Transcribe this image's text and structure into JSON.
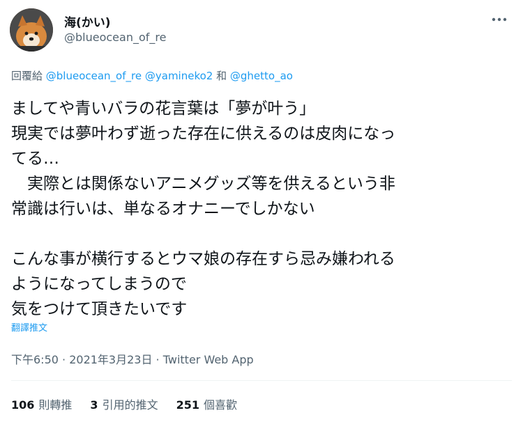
{
  "author": {
    "display_name": "海(かい)",
    "handle": "@blueocean_of_re",
    "avatar_icon": "shiba-dog-avatar"
  },
  "more_icon": "more-horizontal-icon",
  "reply": {
    "prefix": "回覆給 ",
    "mentions": [
      "@blueocean_of_re",
      "@yamineko2",
      "@ghetto_ao"
    ],
    "separator_1": " ",
    "separator_2": " 和 "
  },
  "tweet": {
    "text": "ましてや青いバラの花言葉は「夢が叶う」\n現実では夢叶わず逝った存在に供えるのは皮肉になっ\nてる…\n　実際とは関係ないアニメグッズ等を供えるという非\n常識は行いは、単なるオナニーでしかない\n\nこんな事が横行するとウマ娘の存在すら忌み嫌われる\nようになってしまうので\n気をつけて頂きたいです",
    "translate_label": "翻譯推文"
  },
  "meta": {
    "time": "下午6:50",
    "sep": " · ",
    "date": "2021年3月23日",
    "source": "Twitter Web App"
  },
  "stats": {
    "retweets_count": "106",
    "retweets_label": "則轉推",
    "quotes_count": "3",
    "quotes_label": "引用的推文",
    "likes_count": "251",
    "likes_label": "個喜歡"
  },
  "colors": {
    "text": "#0f1419",
    "secondary": "#536471",
    "link": "#1d9bf0",
    "divider": "#eff3f4"
  }
}
